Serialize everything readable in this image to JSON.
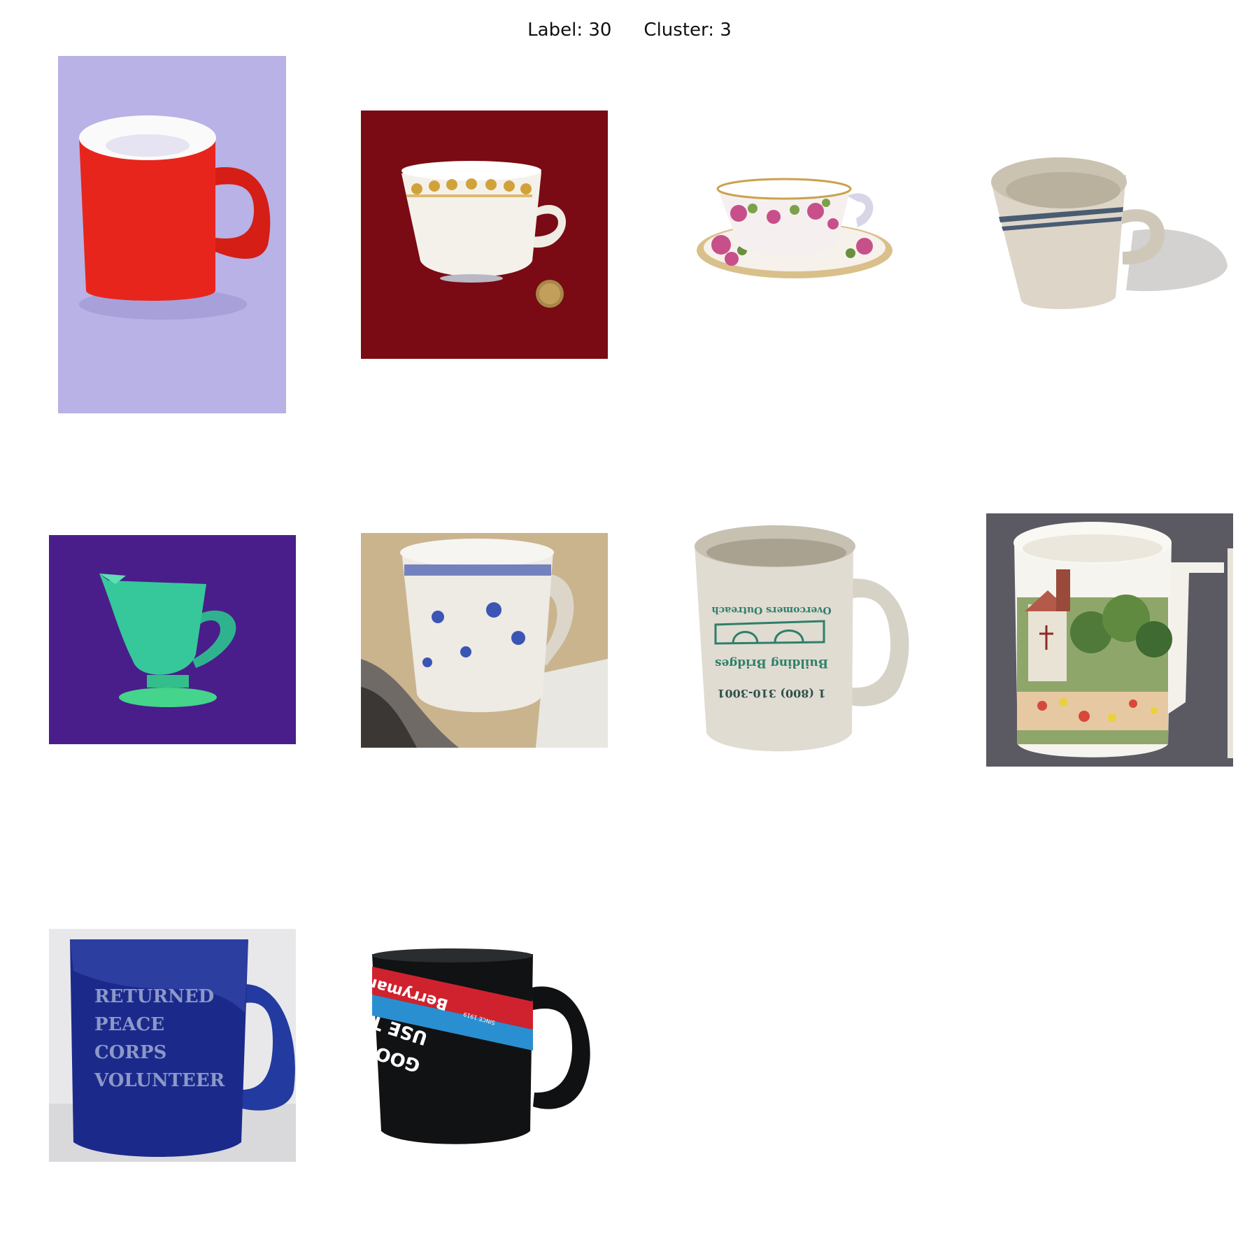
{
  "header": {
    "label_text": "Label: 30",
    "cluster_text": "Cluster: 3"
  },
  "images": [
    {
      "subject": "red mug",
      "colors": {
        "background": "#b8b2e6",
        "body": "#e8251c"
      }
    },
    {
      "subject": "white teacup with gold floral rim",
      "colors": {
        "background": "#7a0a14",
        "body": "#f4f1ea"
      }
    },
    {
      "subject": "rose teacup and saucer",
      "colors": {
        "background": "#ffffff",
        "body": "#f5f0ef"
      }
    },
    {
      "subject": "beige striped mug",
      "colors": {
        "background": "#ffffff",
        "body": "#ddd6c8"
      }
    },
    {
      "subject": "green creamer jug",
      "colors": {
        "background": "#4a1e8a",
        "body": "#36c89a"
      }
    },
    {
      "subject": "blue floral cup on cat",
      "colors": {
        "background": "#c9b48e",
        "body": "#eeeae4"
      }
    },
    {
      "subject": "Overcomers Outreach mug",
      "colors": {
        "background": "#ffffff",
        "body": "#e0dcd2"
      },
      "print": {
        "line1": "Overcomers Outreach",
        "line2": "Building Bridges",
        "line3": "1 (800) 310-3001"
      }
    },
    {
      "subject": "church painting mug",
      "colors": {
        "background": "#5b5a62",
        "body": "#f6f4ee"
      }
    },
    {
      "subject": "blue glass mug",
      "colors": {
        "background": "#e8e8ea",
        "body": "#1b2a8a"
      },
      "print": {
        "line1": "RETURNED",
        "line2": "PEACE",
        "line3": "CORPS",
        "line4": "VOLUNTEER"
      }
    },
    {
      "subject": "black Berryman mug",
      "colors": {
        "background": "#ffffff",
        "body": "#101214"
      },
      "print": {
        "brand": "Berryman",
        "tag": "SINCE 1919",
        "line1": "USE THE",
        "line2": "GOOD STUFF"
      }
    }
  ]
}
